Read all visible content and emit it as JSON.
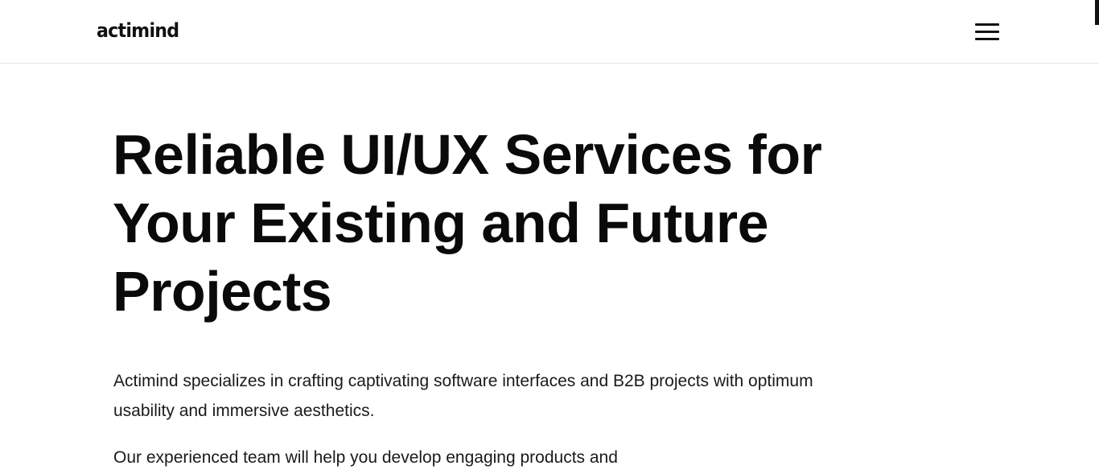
{
  "header": {
    "logo_text": "actimind",
    "menu_icon": "hamburger-menu-icon"
  },
  "hero": {
    "title": "Reliable UI/UX Services for Your Existing and Future Projects",
    "paragraphs": [
      "Actimind specializes in crafting captivating software interfaces and B2B projects with optimum usability and immersive aesthetics.",
      "Our experienced team will help you develop engaging products and"
    ]
  },
  "colors": {
    "background": "#ffffff",
    "text": "#0a0a0a",
    "divider": "#e6e6e6"
  }
}
